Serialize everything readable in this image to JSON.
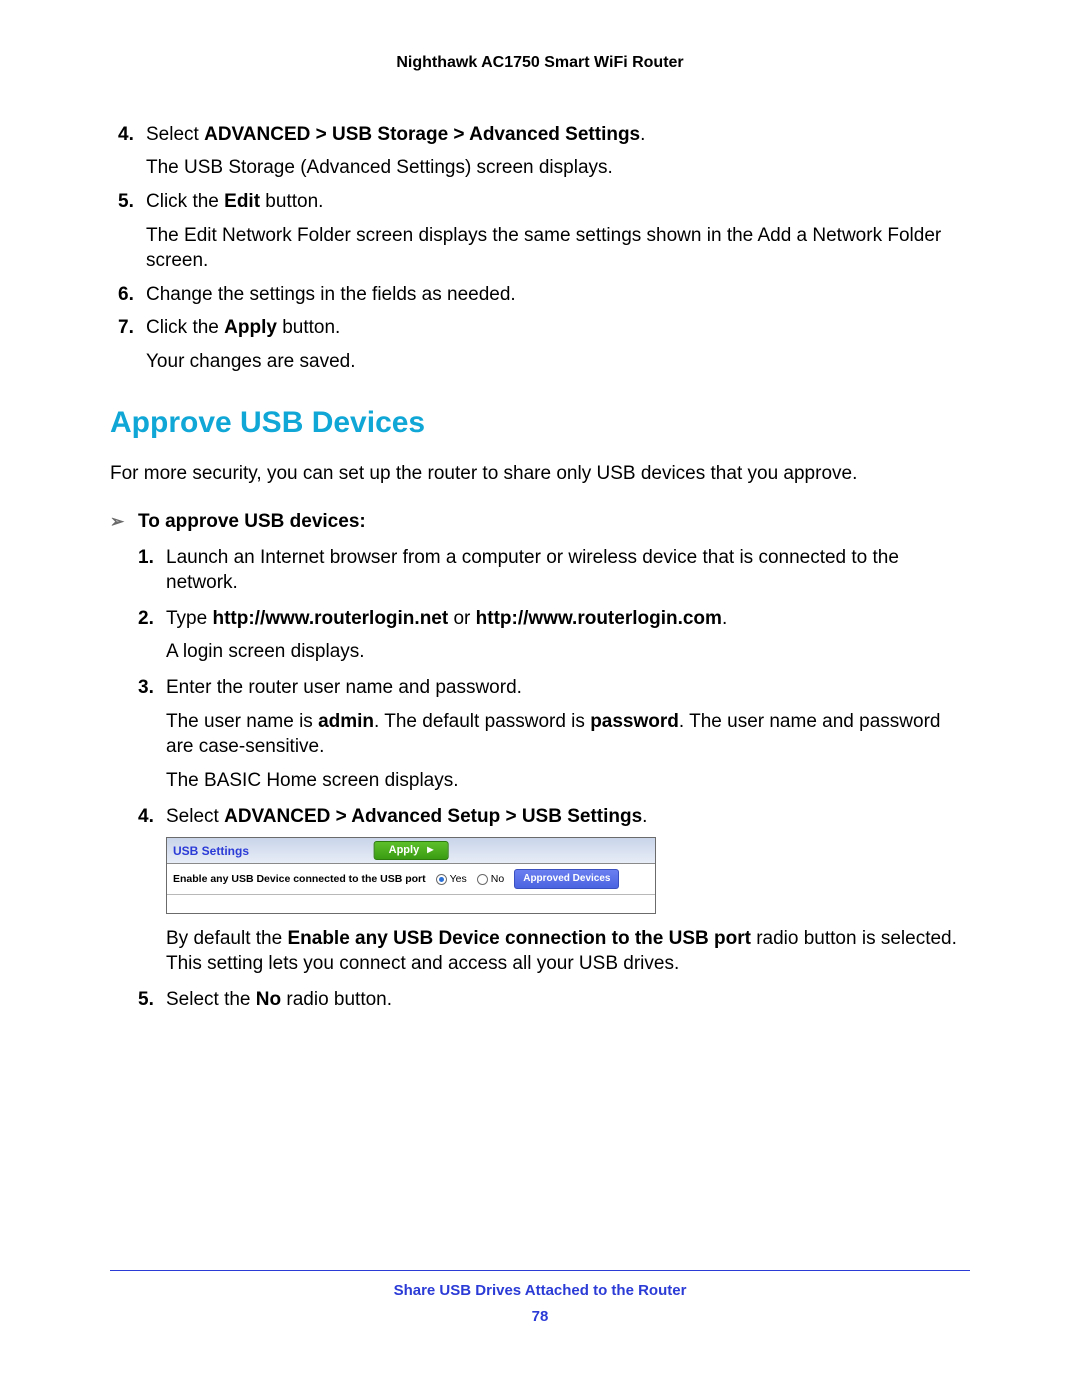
{
  "header": {
    "product": "Nighthawk AC1750 Smart WiFi Router"
  },
  "topSteps": [
    {
      "num": "4.",
      "prefix": "Select ",
      "bold": "ADVANCED > USB Storage > Advanced Settings",
      "suffix": ".",
      "after": [
        "The USB Storage (Advanced Settings) screen displays."
      ]
    },
    {
      "num": "5.",
      "prefix": "Click the ",
      "bold": "Edit",
      "suffix": " button.",
      "after": [
        "The Edit Network Folder screen displays the same settings shown in the Add a Network Folder screen."
      ]
    },
    {
      "num": "6.",
      "prefix": "Change the settings in the fields as needed.",
      "bold": "",
      "suffix": "",
      "after": []
    },
    {
      "num": "7.",
      "prefix": "Click the ",
      "bold": "Apply",
      "suffix": " button.",
      "after": [
        "Your changes are saved."
      ]
    }
  ],
  "section": {
    "heading": "Approve USB Devices",
    "intro": "For more security, you can set up the router to share only USB devices that you approve.",
    "taskLead": "To approve USB devices:"
  },
  "steps": {
    "s1": {
      "num": "1.",
      "text": "Launch an Internet browser from a computer or wireless device that is connected to the network."
    },
    "s2": {
      "num": "2.",
      "prefix": "Type ",
      "bold1": "http://www.routerlogin.net",
      "mid": " or ",
      "bold2": "http://www.routerlogin.com",
      "suffix": ".",
      "after": "A login screen displays."
    },
    "s3": {
      "num": "3.",
      "text": "Enter the router user name and password.",
      "p2_a": "The user name is ",
      "p2_b": "admin",
      "p2_c": ". The default password is ",
      "p2_d": "password",
      "p2_e": ". The user name and password are case-sensitive.",
      "p3": "The BASIC Home screen displays."
    },
    "s4": {
      "num": "4.",
      "prefix": "Select ",
      "bold": "ADVANCED > Advanced Setup > USB Settings",
      "suffix": ".",
      "expl_a": "By default the ",
      "expl_b": "Enable any USB Device connection to the USB port",
      "expl_c": " radio button is selected. This setting lets you connect and access all your USB drives."
    },
    "s5": {
      "num": "5.",
      "prefix": "Select the ",
      "bold": "No",
      "suffix": " radio button."
    }
  },
  "ui": {
    "title": "USB Settings",
    "apply": "Apply",
    "rowLabel": "Enable any USB Device connected to the USB port",
    "yes": "Yes",
    "no": "No",
    "approved": "Approved Devices"
  },
  "footer": {
    "title": "Share USB Drives Attached to the Router",
    "page": "78"
  }
}
